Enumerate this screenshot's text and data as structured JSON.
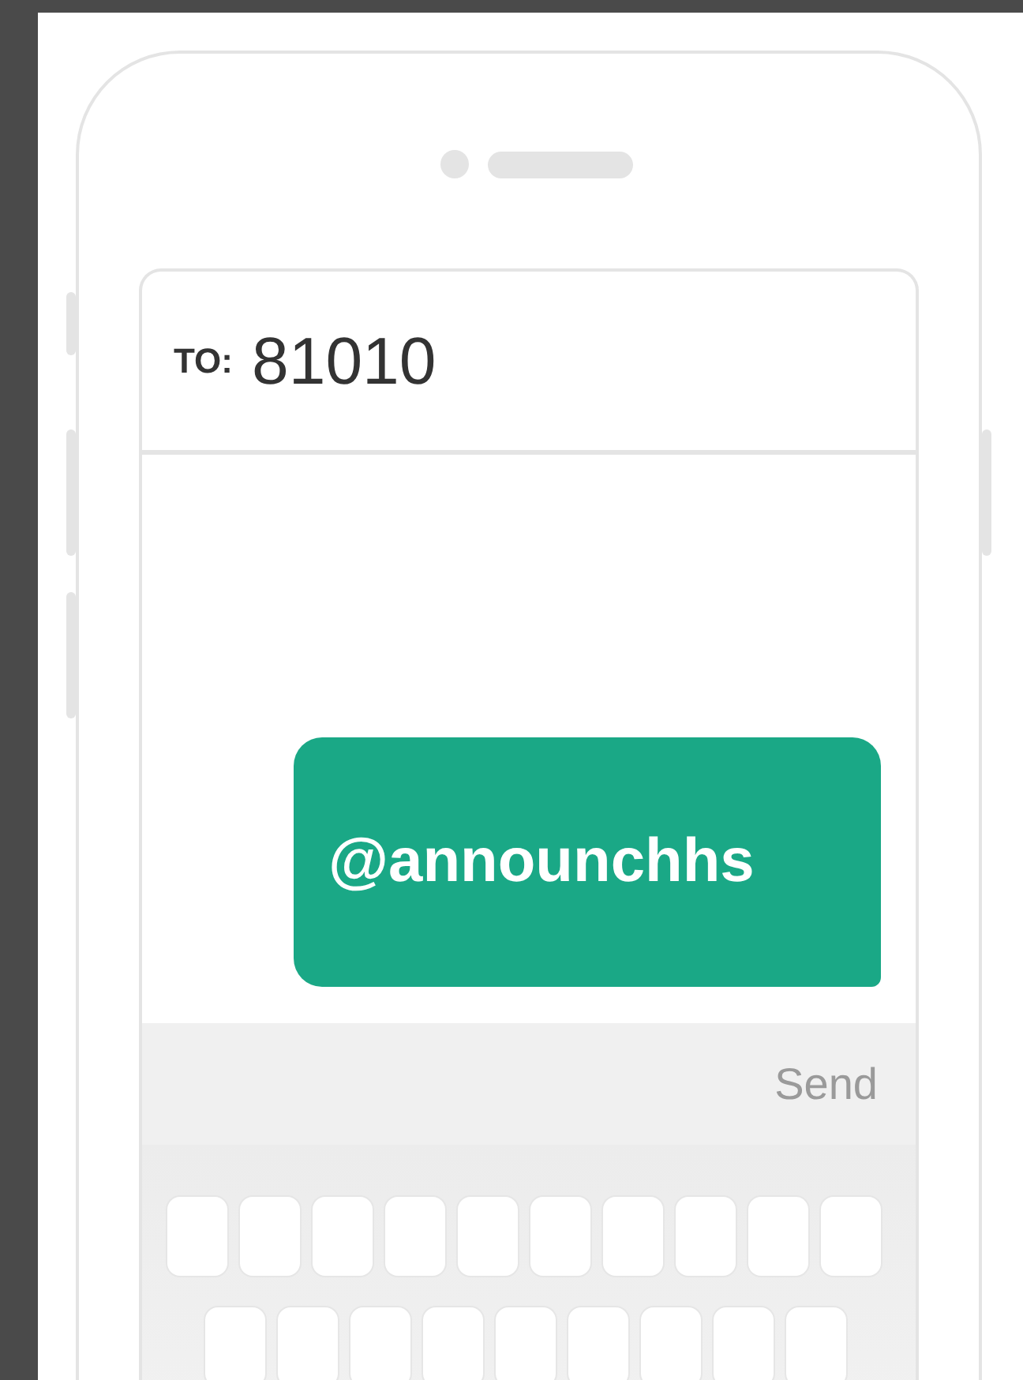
{
  "recipient": {
    "label": "TO:",
    "number": "81010"
  },
  "messages": [
    {
      "text": "@announchhs",
      "outgoing": true
    }
  ],
  "send_button": "Send"
}
